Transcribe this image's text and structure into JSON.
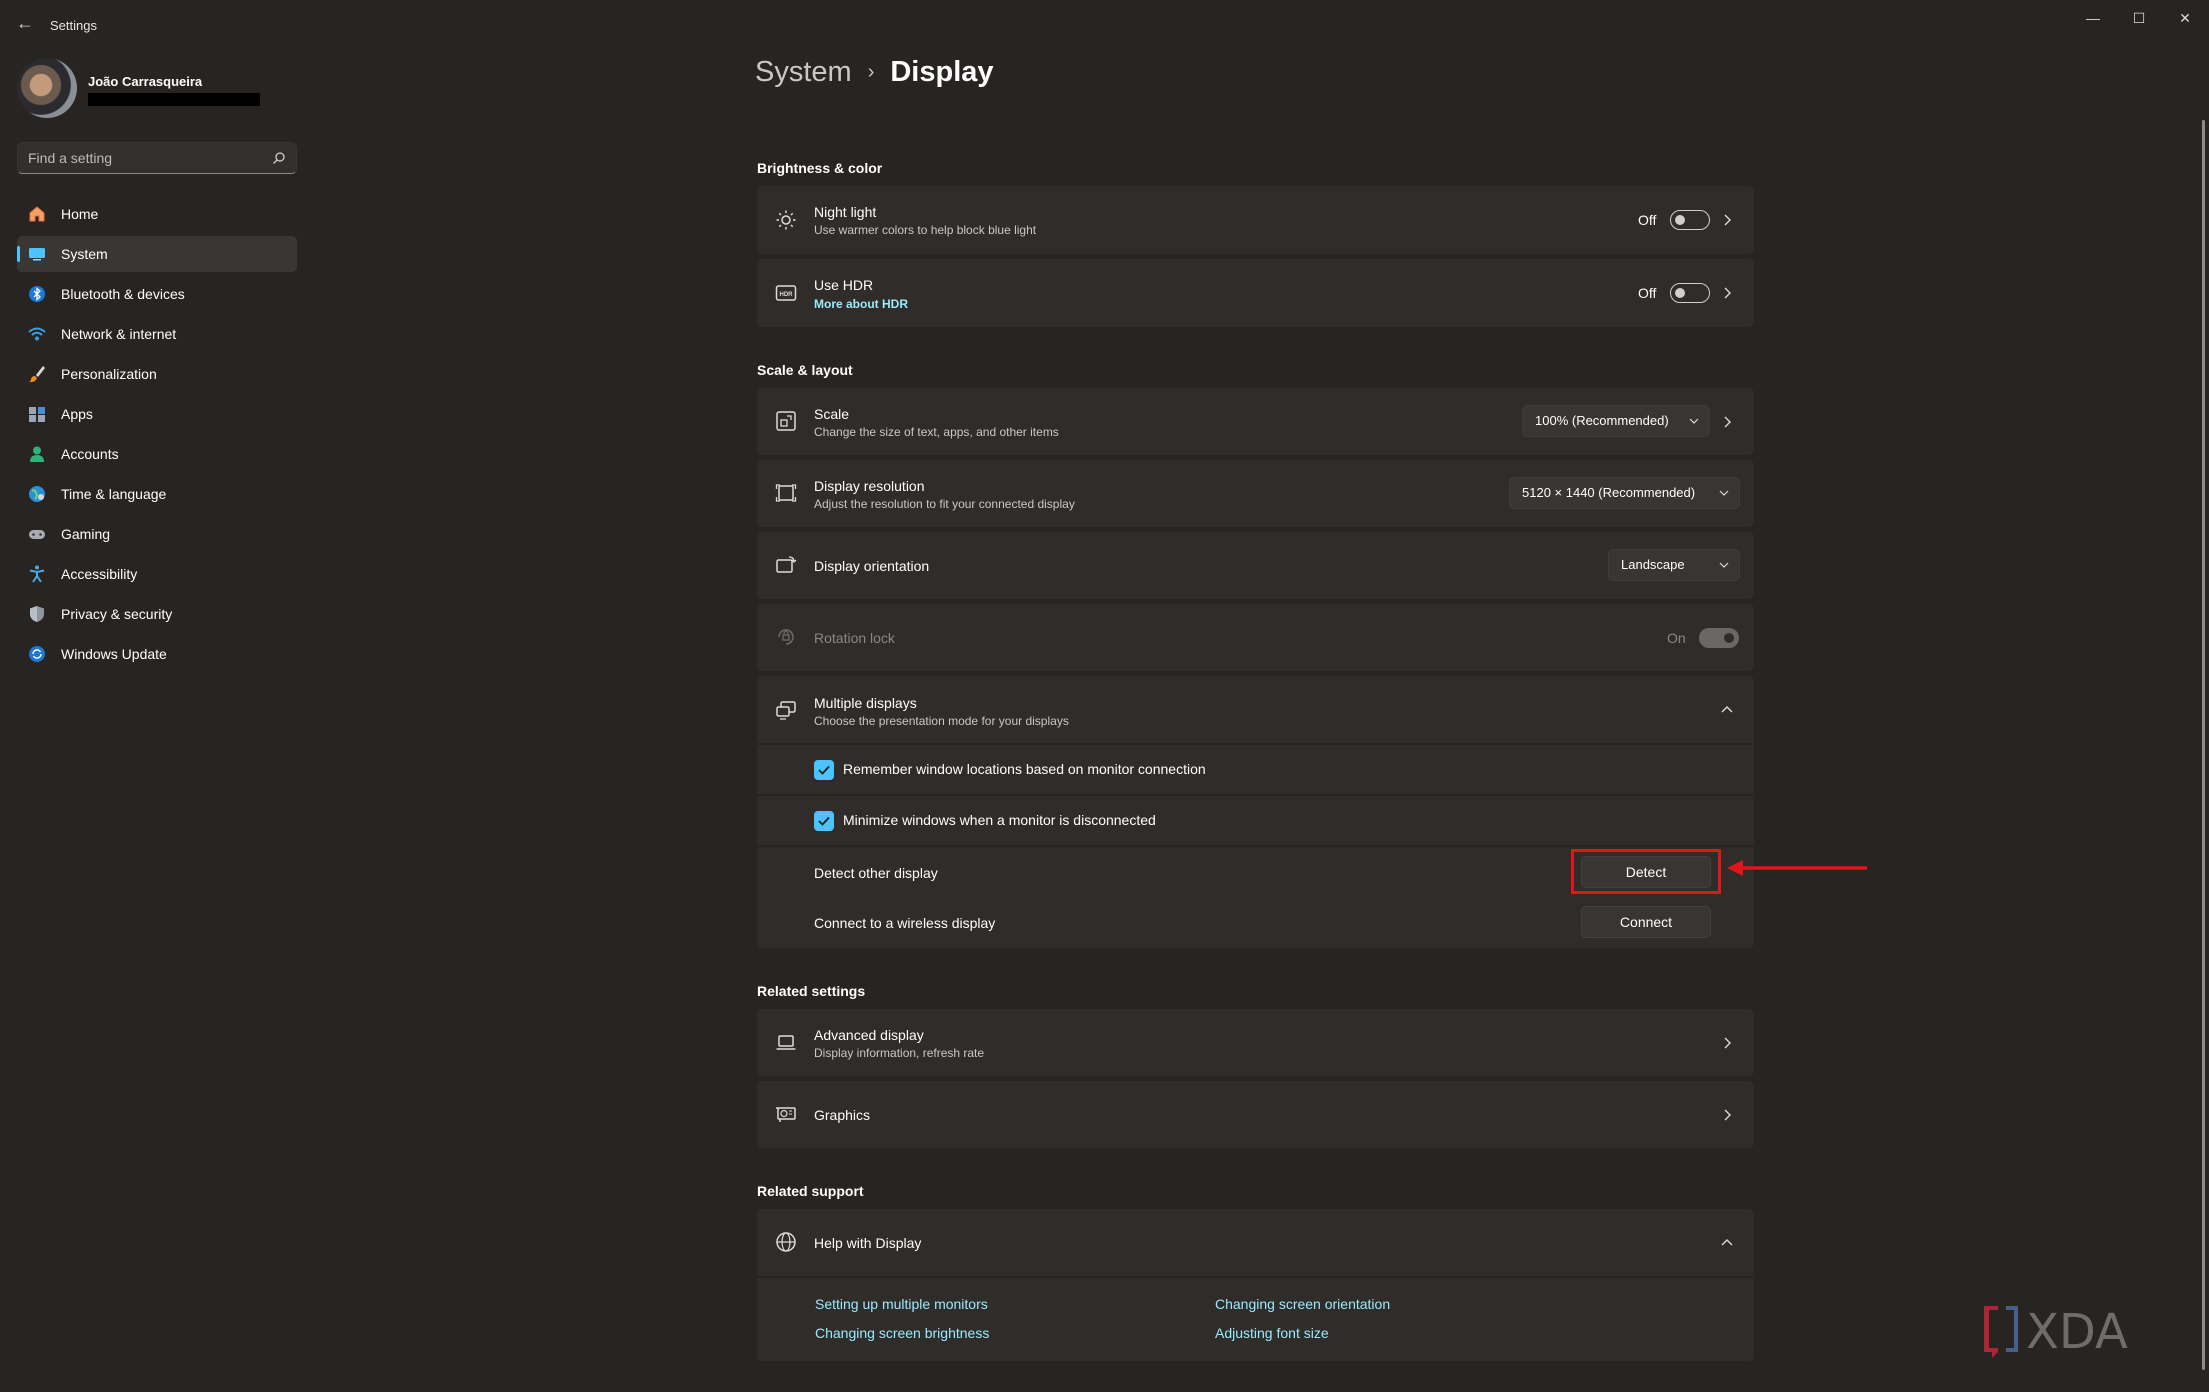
{
  "window": {
    "title": "Settings",
    "minimize": "—",
    "maximize": "☐",
    "close": "✕"
  },
  "user": {
    "name": "João Carrasqueira"
  },
  "search": {
    "placeholder": "Find a setting"
  },
  "nav": [
    {
      "label": "Home",
      "icon": "home-icon"
    },
    {
      "label": "System",
      "icon": "system-icon",
      "active": true
    },
    {
      "label": "Bluetooth & devices",
      "icon": "bluetooth-icon"
    },
    {
      "label": "Network & internet",
      "icon": "network-icon"
    },
    {
      "label": "Personalization",
      "icon": "brush-icon"
    },
    {
      "label": "Apps",
      "icon": "apps-icon"
    },
    {
      "label": "Accounts",
      "icon": "accounts-icon"
    },
    {
      "label": "Time & language",
      "icon": "globe-icon"
    },
    {
      "label": "Gaming",
      "icon": "gamepad-icon"
    },
    {
      "label": "Accessibility",
      "icon": "accessibility-icon"
    },
    {
      "label": "Privacy & security",
      "icon": "shield-icon"
    },
    {
      "label": "Windows Update",
      "icon": "update-icon"
    }
  ],
  "breadcrumb": {
    "parent": "System",
    "separator": "›",
    "current": "Display"
  },
  "brightness": {
    "title": "Brightness & color",
    "night_light": {
      "title": "Night light",
      "subtitle": "Use warmer colors to help block blue light",
      "state": "Off"
    },
    "hdr": {
      "title": "Use HDR",
      "link": "More about HDR",
      "state": "Off"
    }
  },
  "scale_layout": {
    "title": "Scale & layout",
    "scale": {
      "title": "Scale",
      "subtitle": "Change the size of text, apps, and other items",
      "value": "100% (Recommended)"
    },
    "resolution": {
      "title": "Display resolution",
      "subtitle": "Adjust the resolution to fit your connected display",
      "value": "5120 × 1440 (Recommended)"
    },
    "orientation": {
      "title": "Display orientation",
      "value": "Landscape"
    },
    "rotation_lock": {
      "title": "Rotation lock",
      "state": "On"
    },
    "multiple_displays": {
      "title": "Multiple displays",
      "subtitle": "Choose the presentation mode for your displays",
      "remember": "Remember window locations based on monitor connection",
      "minimize": "Minimize windows when a monitor is disconnected",
      "detect_label": "Detect other display",
      "detect_button": "Detect",
      "connect_label": "Connect to a wireless display",
      "connect_button": "Connect"
    }
  },
  "related_settings": {
    "title": "Related settings",
    "advanced": {
      "title": "Advanced display",
      "subtitle": "Display information, refresh rate"
    },
    "graphics": {
      "title": "Graphics"
    }
  },
  "related_support": {
    "title": "Related support",
    "help": {
      "title": "Help with Display"
    },
    "links": [
      "Setting up multiple monitors",
      "Changing screen orientation",
      "Changing screen brightness",
      "Adjusting font size"
    ]
  },
  "colors": {
    "accent": "#4cc2ff",
    "link": "#99ebff",
    "annotation": "#e4141b",
    "background": "#272421",
    "card": "#2f2c29"
  },
  "watermark": "XDA"
}
